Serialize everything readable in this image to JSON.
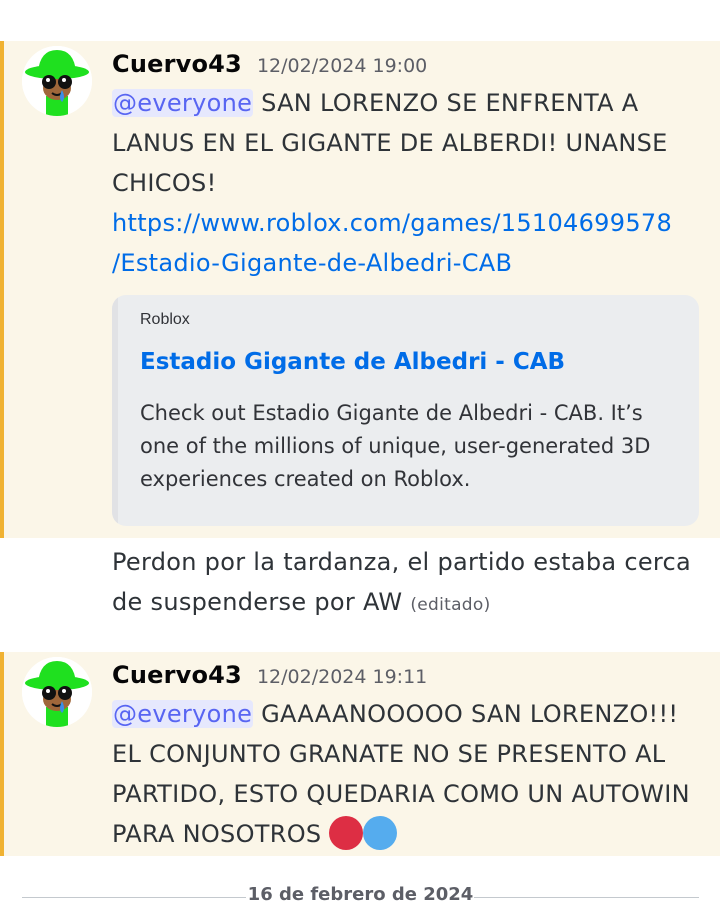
{
  "messages": [
    {
      "author": "Cuervo43",
      "timestamp": "12/02/2024 19:00",
      "mention": "@everyone",
      "text": " SAN LORENZO SE ENFRENTA A LANUS EN EL GIGANTE DE ALBERDI! UNANSE CHICOS!",
      "link_line1": "https://www.roblox.com/games/15104699578",
      "link_line2": "/Estadio-Gigante-de-Albedri-CAB",
      "embed": {
        "provider": "Roblox",
        "title": "Estadio Gigante de Albedri - CAB",
        "description": "Check out Estadio Gigante de Albedri - CAB. It’s one of the millions of unique, user-generated 3D experiences created on Roblox."
      }
    },
    {
      "text": "Perdon por la tardanza, el partido estaba cerca de suspenderse por AW",
      "edited_label": "(editado)"
    },
    {
      "author": "Cuervo43",
      "timestamp": "12/02/2024 19:11",
      "mention": "@everyone",
      "text": " GAAAANOOOOO SAN LORENZO!!! EL CONJUNTO GRANATE NO SE PRESENTO AL PARTIDO, ESTO QUEDARIA COMO UN AUTOWIN PARA NOSOTROS ",
      "emojis": [
        "red-circle-emoji",
        "blue-circle-emoji"
      ]
    }
  ],
  "date_divider": "16 de febrero de 2024",
  "colors": {
    "highlight_bg": "#fbf6e8",
    "highlight_bar": "#f0b232",
    "mention_bg": "#e6e8fd",
    "mention_text": "#5865f2",
    "link": "#006ce7",
    "avatar_green": "#1fe01f",
    "emoji_red": "#dd2e44",
    "emoji_blue": "#55acee"
  }
}
